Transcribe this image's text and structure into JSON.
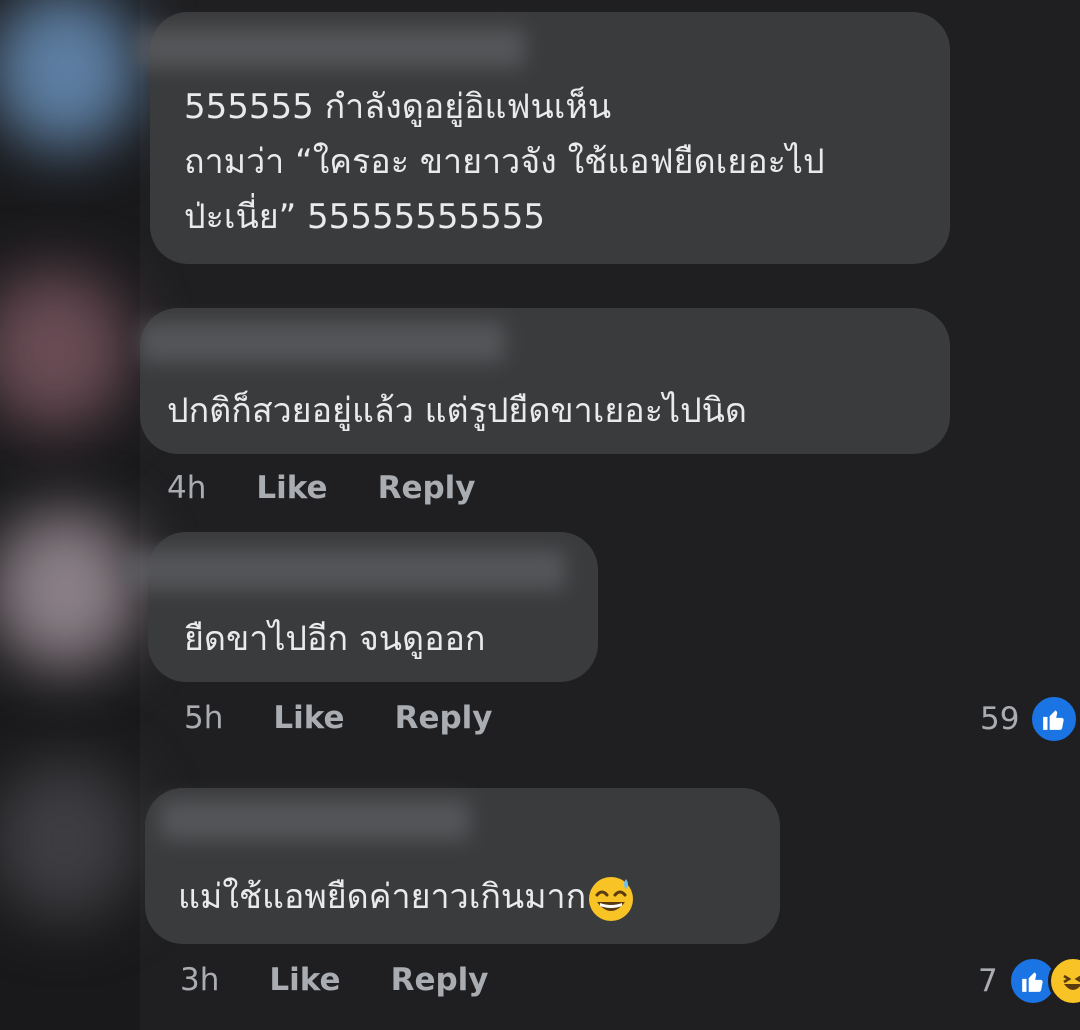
{
  "comments": [
    {
      "lines": [
        "555555  กำลังดูอยู่อิแฟนเห็น",
        "ถามว่า “ใครอะ ขายาวจัง ใช้แอฟยืดเยอะไป",
        "ป่ะเนี่ย” 55555555555"
      ]
    },
    {
      "lines": [
        "ปกติก็สวยอยู่แล้ว แต่รูปยืดขาเยอะไปนิด"
      ],
      "time": "4h",
      "like_label": "Like",
      "reply_label": "Reply"
    },
    {
      "lines": [
        "ยืดขาไปอีก จนดูออก"
      ],
      "time": "5h",
      "like_label": "Like",
      "reply_label": "Reply",
      "reaction_count": "59",
      "reactions": [
        "like-icon"
      ]
    },
    {
      "lines": [
        "แม่ใช้แอพยืดค่ายาวเกินมาก"
      ],
      "trailing_emoji": "grinning-face-with-sweat-icon",
      "time": "3h",
      "like_label": "Like",
      "reply_label": "Reply",
      "reaction_count": "7",
      "reactions": [
        "like-icon",
        "haha-icon"
      ]
    }
  ],
  "colors": {
    "background": "#1f1f21",
    "bubble": "#3a3b3d",
    "like_blue": "#1b74e4",
    "haha_yellow": "#f7c325"
  }
}
